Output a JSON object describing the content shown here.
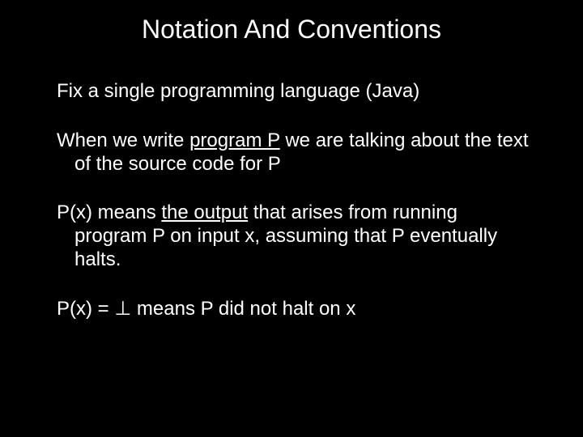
{
  "title": "Notation And Conventions",
  "p1": "Fix a single programming language (Java)",
  "p2a": "When we write ",
  "p2u": "program P",
  "p2b": " we are talking about the text of the source code for P",
  "p3a": "P(x) means ",
  "p3u": "the output",
  "p3b": " that arises from running program P on input x, assuming that P eventually halts.",
  "p4a": "P(x) = ",
  "p4sym": "⊥",
  "p4b": " means P did not halt on x"
}
